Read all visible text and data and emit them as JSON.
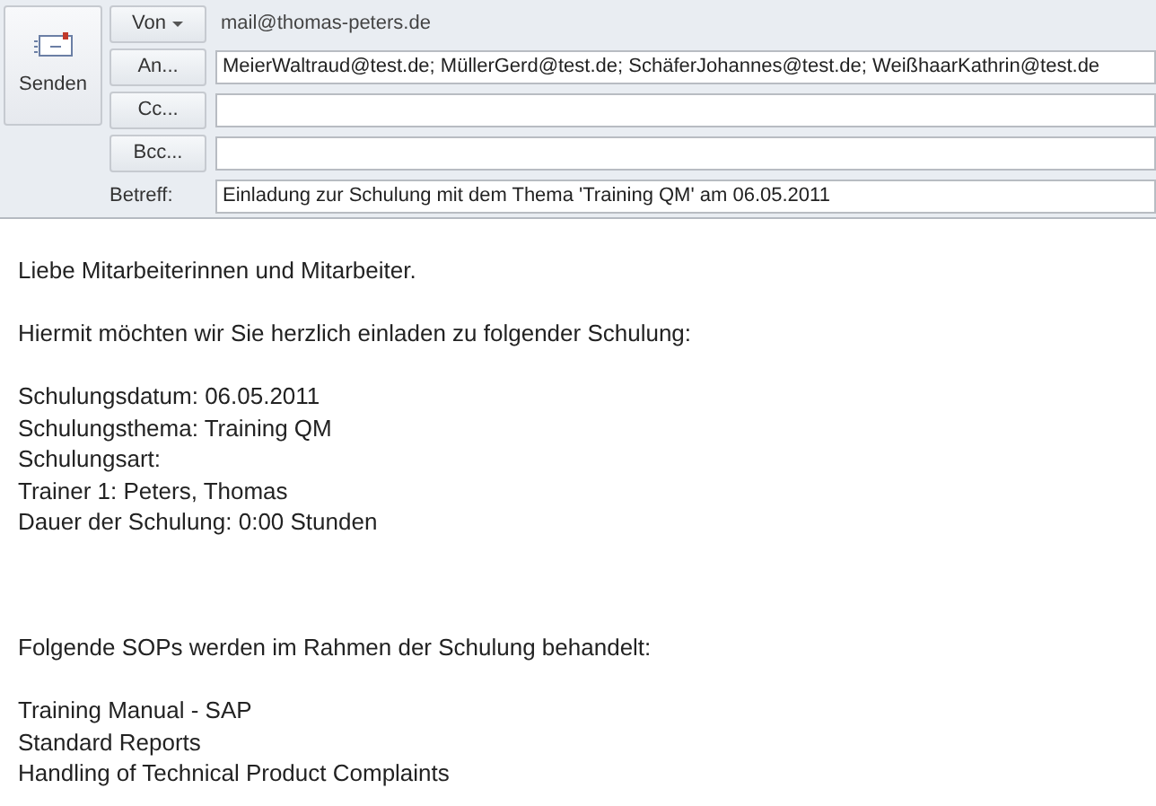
{
  "send_button": {
    "label": "Senden"
  },
  "from": {
    "label": "Von",
    "value": "mail@thomas-peters.de"
  },
  "recipients": [
    {
      "label": "An...",
      "value": "MeierWaltraud@test.de; MüllerGerd@test.de; SchäferJohannes@test.de; WeißhaarKathrin@test.de"
    },
    {
      "label": "Cc..."
    },
    {
      "label": "Bcc..."
    }
  ],
  "subject": {
    "label": "Betreff:",
    "value": "Einladung zur Schulung mit dem Thema 'Training QM' am 06.05.2011"
  },
  "body": [
    [
      "Liebe Mitarbeiterinnen und Mitarbeiter."
    ],
    [
      "Hiermit möchten wir Sie herzlich einladen zu folgender Schulung:"
    ],
    [
      "Schulungsdatum: 06.05.2011",
      "Schulungsthema: Training QM",
      "Schulungsart:",
      "Trainer 1: Peters, Thomas",
      "Dauer der Schulung: 0:00 Stunden"
    ],
    [
      "Folgende SOPs werden im Rahmen der Schulung behandelt:"
    ],
    [
      "Training Manual - SAP",
      "Standard Reports",
      "Handling of Technical Product Complaints"
    ]
  ]
}
